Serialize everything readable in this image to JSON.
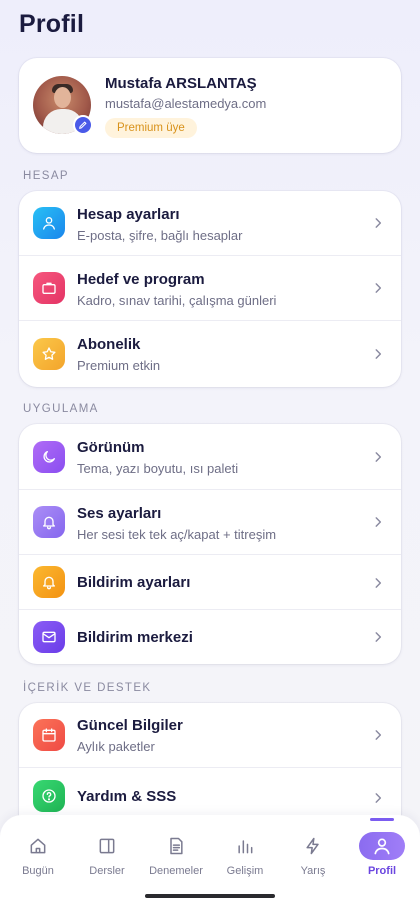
{
  "page": {
    "title": "Profil"
  },
  "profile": {
    "name": "Mustafa ARSLANTAŞ",
    "email": "mustafa@alestamedya.com",
    "badge": "Premium üye"
  },
  "sections": [
    {
      "label": "HESAP",
      "items": [
        {
          "title": "Hesap ayarları",
          "subtitle": "E-posta, şifre, bağlı hesaplar",
          "icon": "user-icon",
          "color": "#1fa8f0"
        },
        {
          "title": "Hedef ve program",
          "subtitle": "Kadro, sınav tarihi, çalışma günleri",
          "icon": "briefcase-icon",
          "color": "#f0476e"
        },
        {
          "title": "Abonelik",
          "subtitle": "Premium etkin",
          "icon": "star-icon",
          "color": "#f6b43a"
        }
      ]
    },
    {
      "label": "UYGULAMA",
      "items": [
        {
          "title": "Görünüm",
          "subtitle": "Tema, yazı boyutu, ısı paleti",
          "icon": "moon-icon",
          "color": "#9a5cf0"
        },
        {
          "title": "Ses ayarları",
          "subtitle": "Her sesi tek tek aç/kapat + titreşim",
          "icon": "bell-icon",
          "color": "#9b7cf2"
        },
        {
          "title": "Bildirim ayarları",
          "subtitle": "",
          "icon": "bell-icon",
          "color": "#f6a51c"
        },
        {
          "title": "Bildirim merkezi",
          "subtitle": "",
          "icon": "mail-icon",
          "color": "#7b4ff0"
        }
      ]
    },
    {
      "label": "İÇERİK VE DESTEK",
      "items": [
        {
          "title": "Güncel Bilgiler",
          "subtitle": "Aylık paketler",
          "icon": "calendar-icon",
          "color": "#f45c4c"
        },
        {
          "title": "Yardım & SSS",
          "subtitle": "",
          "icon": "help-icon",
          "color": "#27c45e"
        }
      ]
    }
  ],
  "tabs": [
    {
      "label": "Bugün",
      "icon": "home-icon"
    },
    {
      "label": "Dersler",
      "icon": "book-icon"
    },
    {
      "label": "Denemeler",
      "icon": "document-icon"
    },
    {
      "label": "Gelişim",
      "icon": "chart-icon"
    },
    {
      "label": "Yarış",
      "icon": "bolt-icon"
    },
    {
      "label": "Profil",
      "icon": "user-icon",
      "active": true
    }
  ],
  "colors": {
    "accent": "#7b5cf0",
    "badge_bg": "#fff3dc",
    "badge_text": "#d8921b"
  }
}
